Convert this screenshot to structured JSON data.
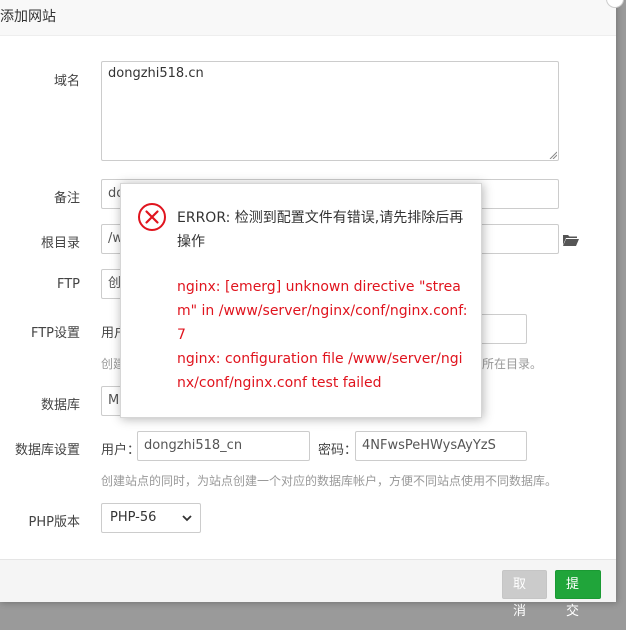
{
  "dialog": {
    "title": "添加网站"
  },
  "form": {
    "domain": {
      "label": "域名",
      "value": "dongzhi518.cn"
    },
    "remark": {
      "label": "备注",
      "value": "do"
    },
    "root": {
      "label": "根目录",
      "value": "/w"
    },
    "ftp": {
      "label": "FTP",
      "value": "创"
    },
    "ftp_settings": {
      "label": "FTP设置",
      "user_label": "用户",
      "hint_left": "创建",
      "hint_right": "所在目录。"
    },
    "database": {
      "label": "数据库",
      "value": "M"
    },
    "db_settings": {
      "label": "数据库设置",
      "user_label": "用户：",
      "user_value": "dongzhi518_cn",
      "password_label": "密码：",
      "password_value": "4NFwsPeHWysAyYzS",
      "hint": "创建站点的同时，为站点创建一个对应的数据库帐户，方便不同站点使用不同数据库。"
    },
    "php": {
      "label": "PHP版本",
      "value": "PHP-56"
    }
  },
  "footer": {
    "cancel_label": "取消",
    "submit_label": "提交"
  },
  "error": {
    "title": "ERROR: 检测到配置文件有错误,请先排除后再操作",
    "detail_line1": "nginx: [emerg] unknown directive \"stream\" in /www/server/nginx/conf/nginx.conf:7",
    "detail_line2": "nginx: configuration file /www/server/nginx/conf/nginx.conf test failed"
  },
  "colors": {
    "accent_green": "#20a53a",
    "error_red": "#e0141e"
  },
  "icons": {
    "error": "error-x-circle-icon",
    "folder": "folder-icon",
    "caret": "chevron-down-icon"
  }
}
